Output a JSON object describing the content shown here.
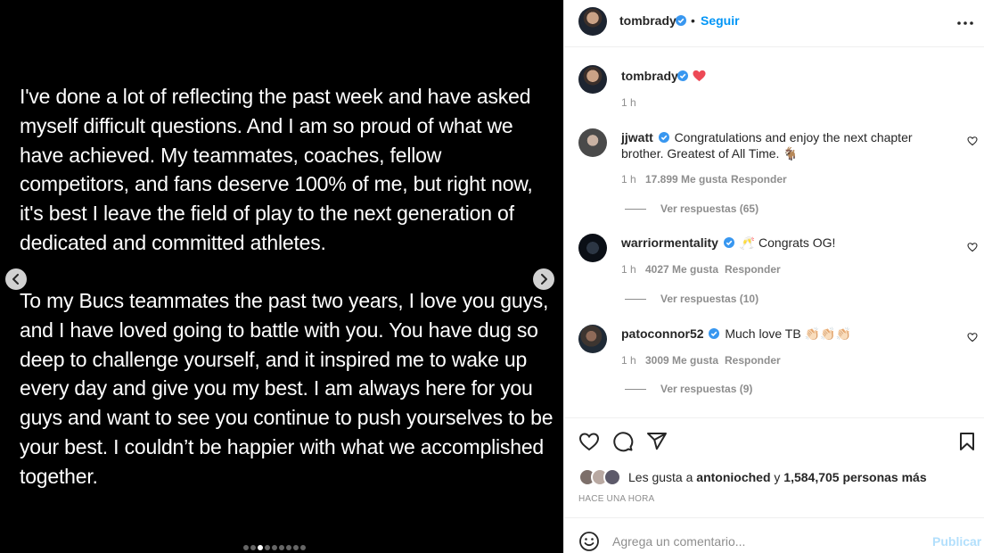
{
  "media": {
    "paragraph_1": "I've done a lot of reflecting the past week and have asked myself difficult questions. And I am so proud of what we have achieved. My teammates, coaches, fellow competitors, and fans deserve 100% of me, but right now, it's best I leave the field of play to the next generation of dedicated and committed athletes.",
    "paragraph_2": "To my Bucs teammates the past two years, I love you guys, and I have loved going to battle with you. You have dug so deep to challenge yourself, and it inspired me to wake up every day and give you my best. I am always here for you guys and want to see you continue to push yourselves to be your best. I couldn’t be happier with what we accomplished together.",
    "carousel": {
      "total": 9,
      "active_index": 2
    }
  },
  "header": {
    "username": "tombrady",
    "separator": "•",
    "follow_label": "Seguir"
  },
  "caption": {
    "username": "tombrady",
    "time": "1 h"
  },
  "comments": [
    {
      "username": "jjwatt",
      "text": "Congratulations and enjoy the next chapter brother. Greatest of All Time. 🐐",
      "time": "1 h",
      "likes": "17.899 Me gusta",
      "reply_label": "Responder",
      "view_replies": "Ver respuestas (65)"
    },
    {
      "username": "warriormentality",
      "text": "🥂 Congrats OG!",
      "time": "1 h",
      "likes": "4027 Me gusta",
      "reply_label": "Responder",
      "view_replies": "Ver respuestas (10)"
    },
    {
      "username": "patoconnor52",
      "text": "Much love TB 👏🏻👏🏻👏🏻",
      "time": "1 h",
      "likes": "3009 Me gusta",
      "reply_label": "Responder",
      "view_replies": "Ver respuestas (9)"
    }
  ],
  "likes_summary": {
    "prefix": "Les gusta a",
    "user": "antonioched",
    "connector": "y",
    "others": "1,584,705 personas más"
  },
  "posted_time": "HACE UNA HORA",
  "composer": {
    "placeholder": "Agrega un comentario...",
    "publish_label": "Publicar"
  },
  "colors": {
    "accent": "#0095f6",
    "verified": "#3897f0",
    "heart_red": "#ed4956",
    "muted_text": "#8e8e8e",
    "publish_disabled": "#b2dffc"
  }
}
